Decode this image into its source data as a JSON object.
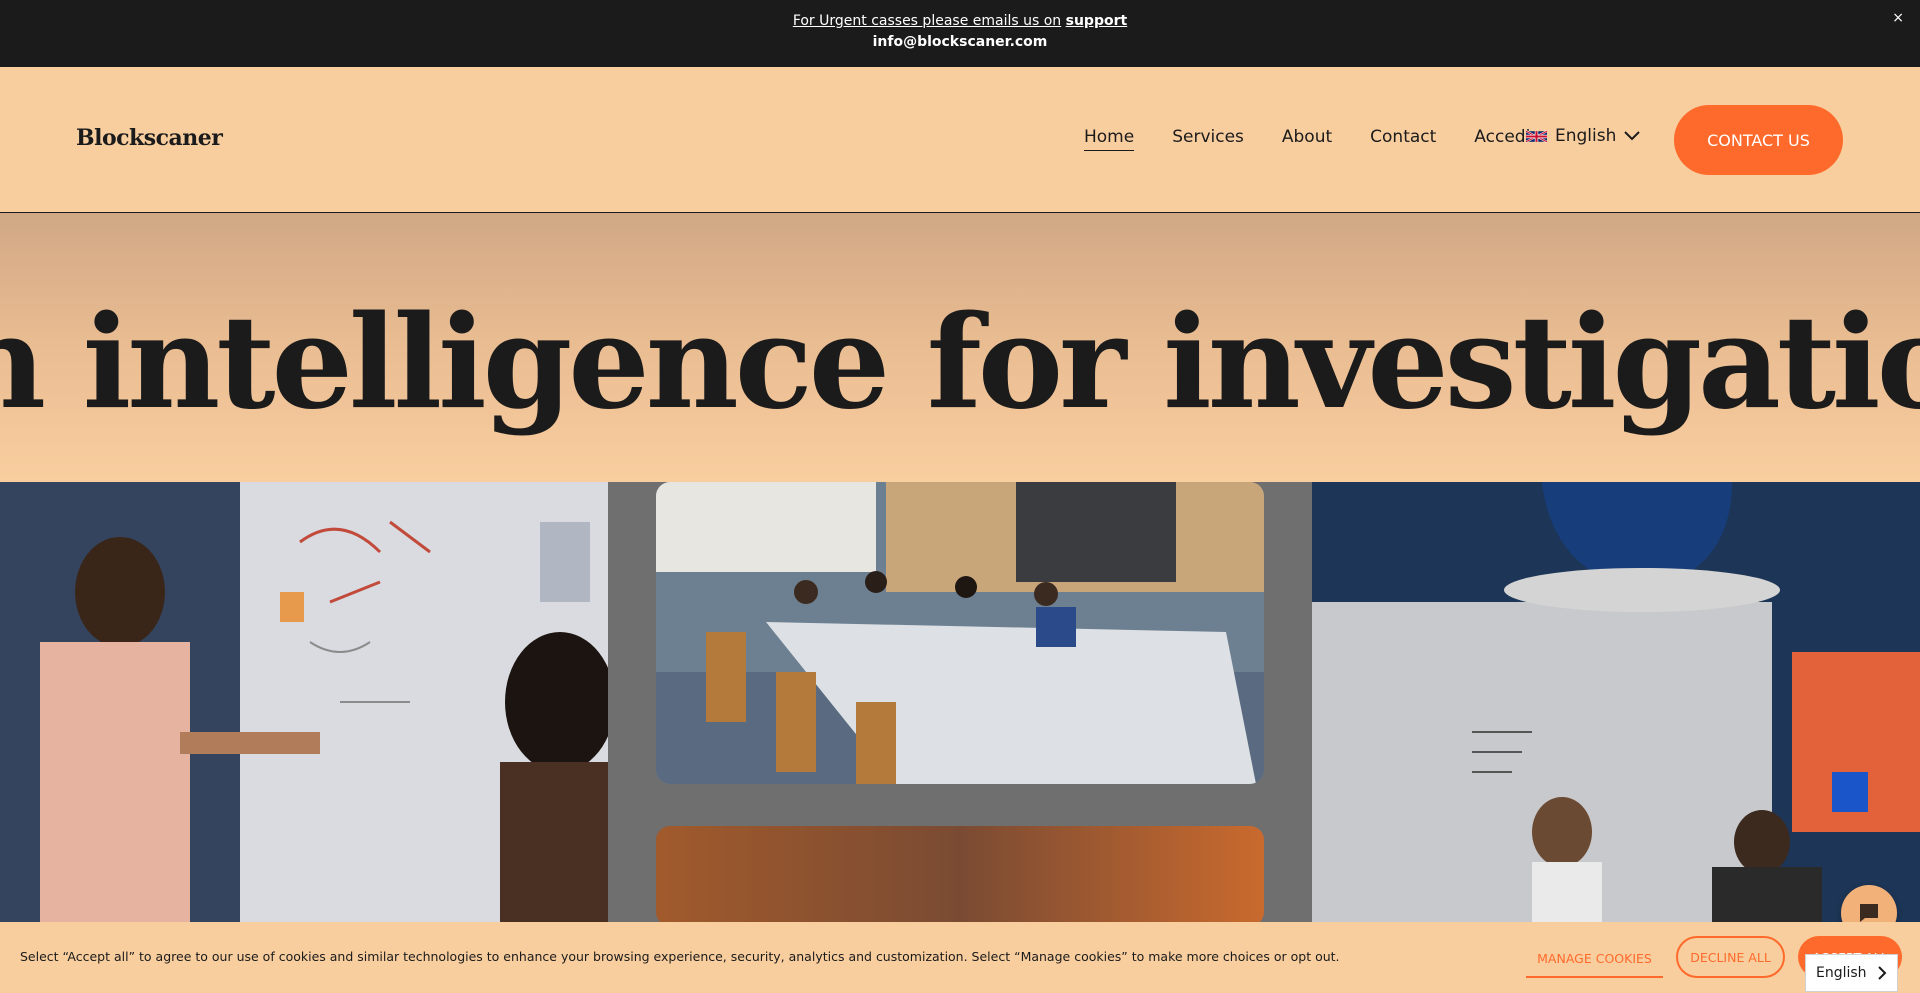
{
  "announcement": {
    "text": "For Urgent casses please emails us on",
    "link": "support",
    "email": "info@blockscaner.com",
    "close": "×"
  },
  "header": {
    "logo": "Blockscaner",
    "nav": [
      "Home",
      "Services",
      "About",
      "Contact",
      "Accedi"
    ],
    "active_nav": "Home",
    "language": "English",
    "cta": "CONTACT US"
  },
  "hero": {
    "headline": "n intelligence for investigations, risk, a"
  },
  "cookie": {
    "text": "Select “Accept all” to agree to our use of cookies and similar technologies to enhance your browsing experience, security, analytics and customization. Select “Manage cookies” to make more choices or opt out.",
    "manage": "MANAGE COOKIES",
    "decline": "DECLINE ALL",
    "accept": "ACCEPT ALL"
  },
  "language_widget": {
    "label": "English"
  },
  "colors": {
    "accent": "#fe6a2b",
    "background": "#f9ce9f",
    "dark": "#1b1b1b"
  },
  "icons": {
    "close": "close-icon",
    "flag": "uk-flag-icon",
    "dropdown": "chevron-down-icon",
    "chat": "chat-icon",
    "widget_arrow": "chevron-right-icon"
  }
}
